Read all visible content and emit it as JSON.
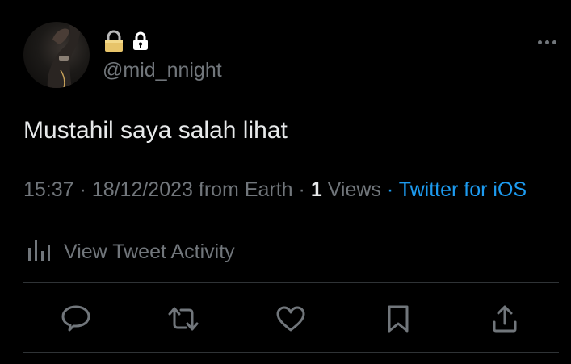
{
  "tweet": {
    "author": {
      "handle": "@mid_nnight",
      "name_icons": [
        "locked-padlock-emoji",
        "lock-icon"
      ]
    },
    "text": "Mustahil saya salah lihat",
    "meta": {
      "time": "15:37",
      "date": "18/12/2023",
      "location": "from Earth",
      "views_count": "1",
      "views_label": "Views",
      "client": "Twitter for iOS",
      "separator": "·"
    },
    "activity_label": "View Tweet Activity",
    "actions": [
      "reply-icon",
      "retweet-icon",
      "like-icon",
      "bookmark-icon",
      "share-icon"
    ]
  },
  "colors": {
    "background": "#000000",
    "primary_text": "#e7e9ea",
    "secondary_text": "#71767b",
    "accent": "#1d9bf0",
    "divider": "#2f3336"
  }
}
